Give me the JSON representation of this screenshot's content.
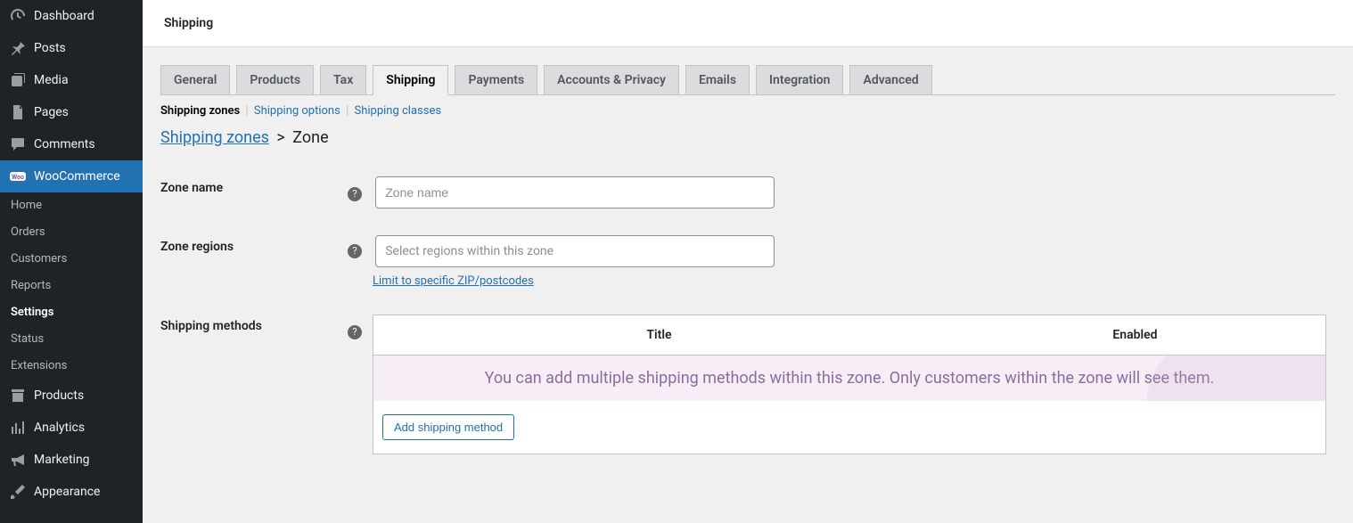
{
  "sidebar": {
    "items": [
      {
        "label": "Dashboard"
      },
      {
        "label": "Posts"
      },
      {
        "label": "Media"
      },
      {
        "label": "Pages"
      },
      {
        "label": "Comments"
      },
      {
        "label": "WooCommerce"
      },
      {
        "label": "Products"
      },
      {
        "label": "Analytics"
      },
      {
        "label": "Marketing"
      },
      {
        "label": "Appearance"
      }
    ],
    "submenu": [
      {
        "label": "Home"
      },
      {
        "label": "Orders"
      },
      {
        "label": "Customers"
      },
      {
        "label": "Reports"
      },
      {
        "label": "Settings"
      },
      {
        "label": "Status"
      },
      {
        "label": "Extensions"
      }
    ]
  },
  "header": {
    "title": "Shipping"
  },
  "tabs": [
    {
      "label": "General"
    },
    {
      "label": "Products"
    },
    {
      "label": "Tax"
    },
    {
      "label": "Shipping"
    },
    {
      "label": "Payments"
    },
    {
      "label": "Accounts & Privacy"
    },
    {
      "label": "Emails"
    },
    {
      "label": "Integration"
    },
    {
      "label": "Advanced"
    }
  ],
  "subtabs": {
    "zones": "Shipping zones",
    "options": "Shipping options",
    "classes": "Shipping classes"
  },
  "breadcrumb": {
    "link": "Shipping zones",
    "current": "Zone"
  },
  "form": {
    "zone_name": {
      "label": "Zone name",
      "placeholder": "Zone name",
      "value": ""
    },
    "zone_regions": {
      "label": "Zone regions",
      "placeholder": "Select regions within this zone",
      "zip_link": "Limit to specific ZIP/postcodes"
    },
    "shipping_methods": {
      "label": "Shipping methods",
      "col_title": "Title",
      "col_enabled": "Enabled",
      "blank_msg": "You can add multiple shipping methods within this zone. Only customers within the zone will see them.",
      "add_btn": "Add shipping method"
    }
  }
}
